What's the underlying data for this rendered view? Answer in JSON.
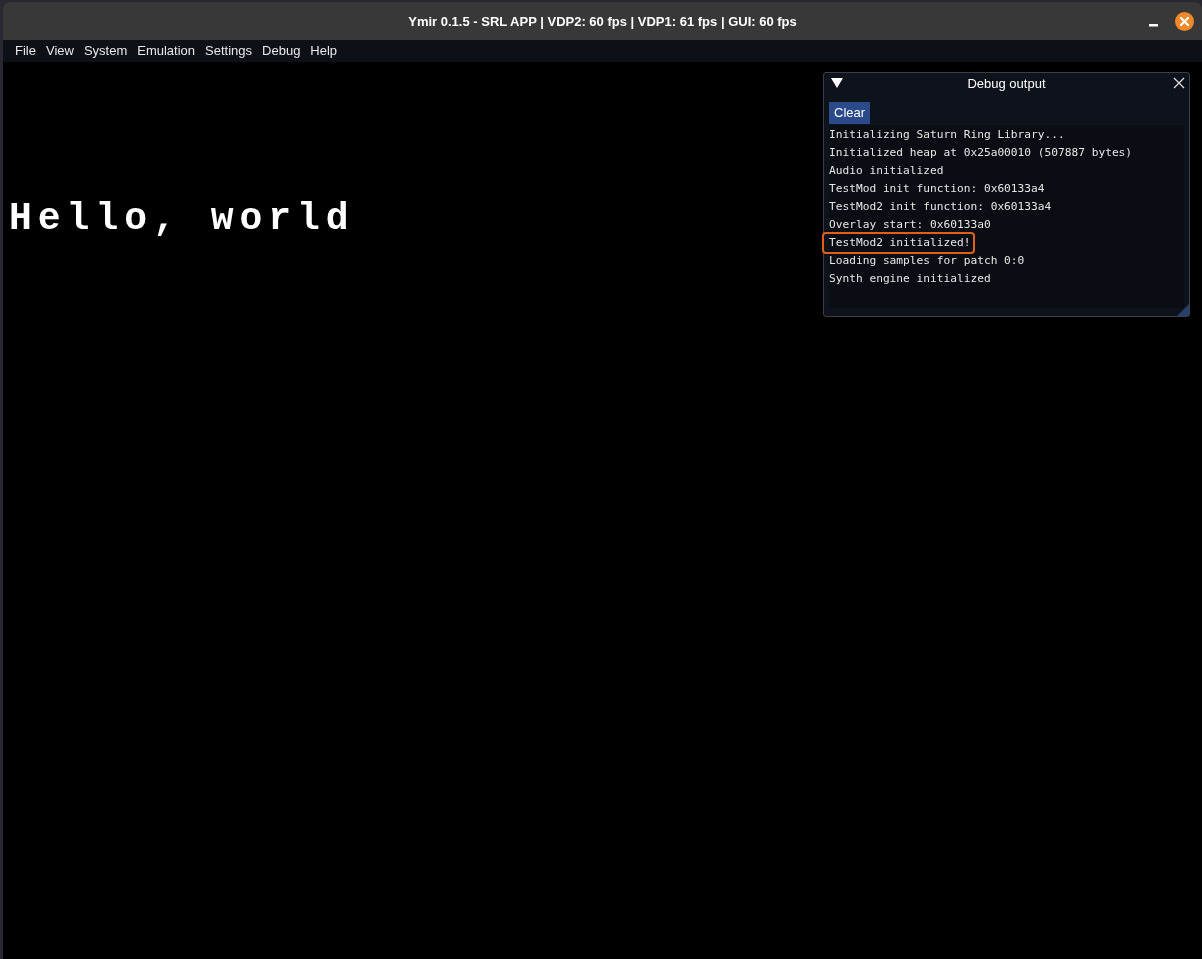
{
  "window": {
    "title": "Ymir 0.1.5 - SRL APP | VDP2: 60 fps | VDP1: 61 fps | GUI: 60 fps"
  },
  "menu": [
    "File",
    "View",
    "System",
    "Emulation",
    "Settings",
    "Debug",
    "Help"
  ],
  "screen": {
    "text": "Hello, world"
  },
  "debug_window": {
    "title": "Debug output",
    "clear_button": "Clear",
    "lines": [
      {
        "text": "Initializing Saturn Ring Library...",
        "highlighted": false
      },
      {
        "text": "Initialized heap at 0x25a00010 (507887 bytes)",
        "highlighted": false
      },
      {
        "text": "Audio initialized",
        "highlighted": false
      },
      {
        "text": "TestMod init function: 0x60133a4",
        "highlighted": false
      },
      {
        "text": "TestMod2 init function: 0x60133a4",
        "highlighted": false
      },
      {
        "text": "Overlay start: 0x60133a0",
        "highlighted": false
      },
      {
        "text": "TestMod2 initialized!",
        "highlighted": true
      },
      {
        "text": "Loading samples for patch 0:0",
        "highlighted": false
      },
      {
        "text": "Synth engine initialized",
        "highlighted": false
      }
    ]
  }
}
